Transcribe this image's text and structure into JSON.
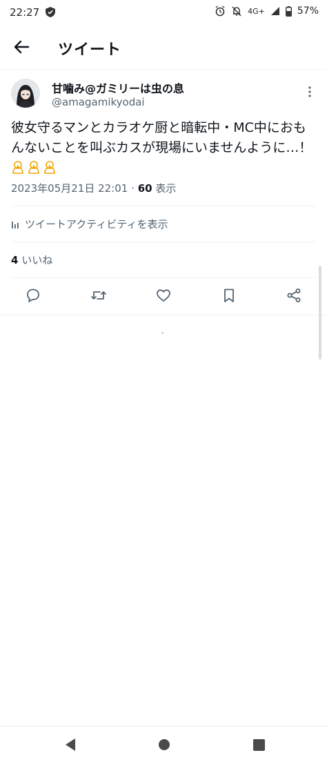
{
  "status_bar": {
    "time": "22:27",
    "network": "4G+",
    "battery": "57%",
    "icons": [
      "shield-icon",
      "alarm-icon",
      "mute-icon",
      "signal-icon",
      "battery-icon"
    ]
  },
  "header": {
    "title": "ツイート",
    "back_icon": "arrow-left-icon"
  },
  "tweet": {
    "author_name": "甘噛み@ガミリーは虫の息",
    "author_handle": "@amagamikyodai",
    "text": "彼女守るマンとカラオケ厨と暗転中・MC中におもんないことを叫ぶカスが現場にいませんように…！",
    "emoji": [
      "pray-icon",
      "pray-icon",
      "pray-icon"
    ],
    "date": "2023年05月21日 22:01",
    "separator": "·",
    "views_count": "60",
    "views_label": "表示",
    "analytics_label": "ツイートアクティビティを表示",
    "likes_count": "4",
    "likes_label": "いいね"
  },
  "actions": [
    "reply-icon",
    "retweet-icon",
    "like-icon",
    "bookmark-icon",
    "share-icon"
  ],
  "colors": {
    "text": "#0f1419",
    "secondary": "#536471",
    "divider": "#eff3f4",
    "emoji": "#f0a500"
  }
}
